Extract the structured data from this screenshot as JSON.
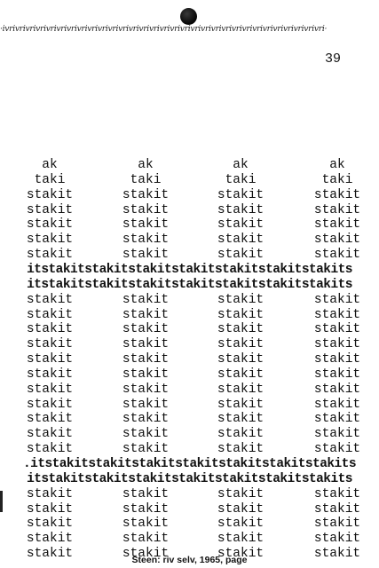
{
  "header": {
    "strip_text": "·ivrivrivrivrivrivrivrivrivrivrivrivrivrivrivrivrivrivrivrivrivrivrivrivrivrivrivrivrivrivrivri·",
    "page_number": "39"
  },
  "poem": {
    "rows": [
      {
        "type": "cols",
        "cells": [
          "ak",
          "ak",
          "ak",
          "ak"
        ]
      },
      {
        "type": "cols",
        "cells": [
          "taki",
          "taki",
          "taki",
          "taki"
        ]
      },
      {
        "type": "cols",
        "cells": [
          "stakit",
          "stakit",
          "stakit",
          "stakit"
        ]
      },
      {
        "type": "cols",
        "cells": [
          "stakit",
          "stakit",
          "stakit",
          "stakit"
        ]
      },
      {
        "type": "cols",
        "cells": [
          "stakit",
          "stakit",
          "stakit",
          "stakit"
        ]
      },
      {
        "type": "cols",
        "cells": [
          "stakit",
          "stakit",
          "stakit",
          "stakit"
        ]
      },
      {
        "type": "cols",
        "cells": [
          "stakit",
          "stakit",
          "stakit",
          "stakit"
        ]
      },
      {
        "type": "full",
        "text": "itstakitstakitstakitstakitstakitstakitstakits"
      },
      {
        "type": "full",
        "text": "itstakitstakitstakitstakitstakitstakitstakits"
      },
      {
        "type": "cols",
        "cells": [
          "stakit",
          "stakit",
          "stakit",
          "stakit"
        ]
      },
      {
        "type": "cols",
        "cells": [
          "stakit",
          "stakit",
          "stakit",
          "stakit"
        ]
      },
      {
        "type": "cols",
        "cells": [
          "stakit",
          "stakit",
          "stakit",
          "stakit"
        ]
      },
      {
        "type": "cols",
        "cells": [
          "stakit",
          "stakit",
          "stakit",
          "stakit"
        ]
      },
      {
        "type": "cols",
        "cells": [
          "stakit",
          "stakit",
          "stakit",
          "stakit"
        ]
      },
      {
        "type": "cols",
        "cells": [
          "stakit",
          "stakit",
          "stakit",
          "stakit"
        ]
      },
      {
        "type": "cols",
        "cells": [
          "stakit",
          "stakit",
          "stakit",
          "stakit"
        ]
      },
      {
        "type": "cols",
        "cells": [
          "stakit",
          "stakit",
          "stakit",
          "stakit"
        ]
      },
      {
        "type": "cols",
        "cells": [
          "stakit",
          "stakit",
          "stakit",
          "stakit"
        ]
      },
      {
        "type": "cols",
        "cells": [
          "stakit",
          "stakit",
          "stakit",
          "stakit"
        ]
      },
      {
        "type": "cols",
        "cells": [
          "stakit",
          "stakit",
          "stakit",
          "stakit"
        ]
      },
      {
        "type": "full",
        "text": ".itstakitstakitstakitstakitstakitstakitstakits"
      },
      {
        "type": "full",
        "text": "itstakitstakitstakitstakitstakitstakitstakits"
      },
      {
        "type": "cols",
        "cells": [
          "stakit",
          "stakit",
          "stakit",
          "stakit"
        ]
      },
      {
        "type": "cols",
        "cells": [
          "stakit",
          "stakit",
          "stakit",
          "stakit"
        ]
      },
      {
        "type": "cols",
        "cells": [
          "stakit",
          "stakit",
          "stakit",
          "stakit"
        ]
      },
      {
        "type": "cols",
        "cells": [
          "stakit",
          "stakit",
          "stakit",
          "stakit"
        ]
      },
      {
        "type": "cols",
        "cells": [
          "stakit",
          "stakit",
          "stakit",
          "stakit"
        ]
      }
    ]
  },
  "caption": "Steen: riv selv, 1965, page"
}
